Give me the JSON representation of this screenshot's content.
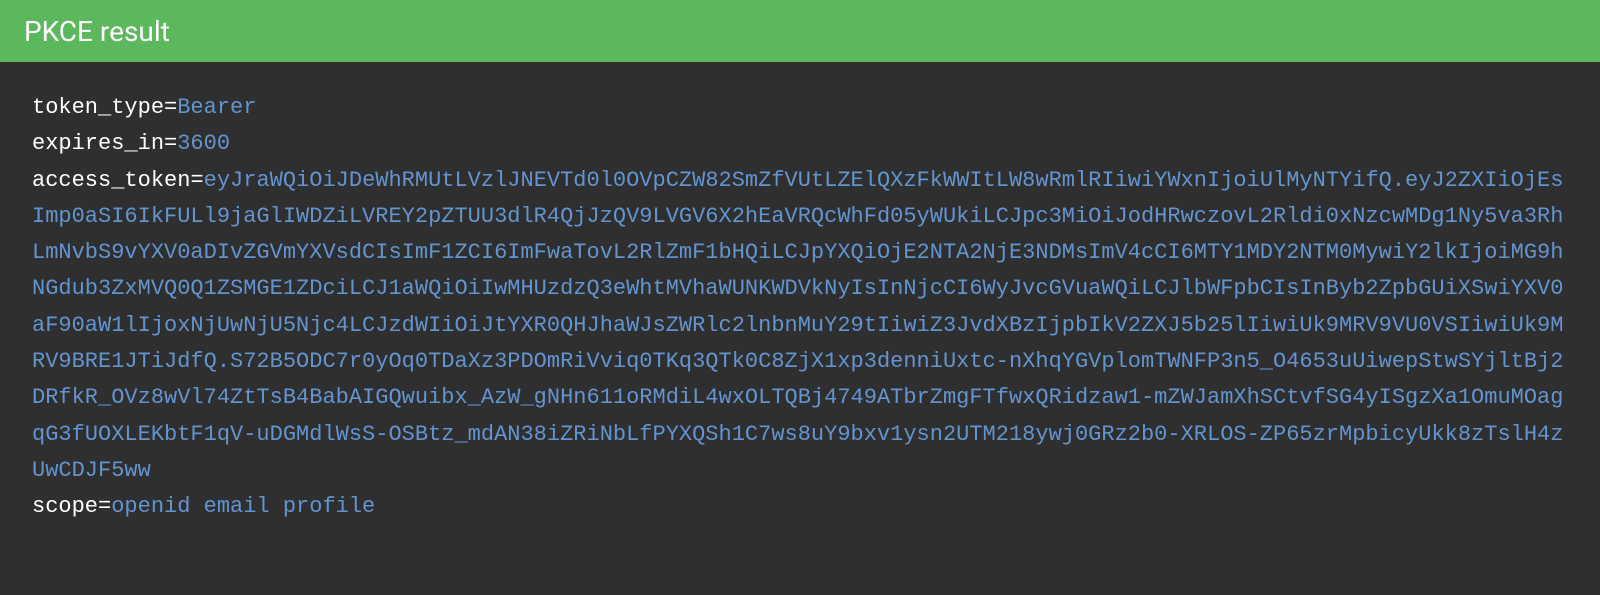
{
  "header": {
    "title": "PKCE result"
  },
  "result": {
    "entries": [
      {
        "key": "token_type",
        "value": "Bearer"
      },
      {
        "key": "expires_in",
        "value": "3600"
      },
      {
        "key": "access_token",
        "value": "eyJraWQiOiJDeWhRMUtLVzlJNEVTd0l0OVpCZW82SmZfVUtLZElQXzFkWWItLW8wRmlRIiwiYWxnIjoiUlMyNTYifQ.eyJ2ZXIiOjEsImp0aSI6IkFULl9jaGlIWDZiLVREY2pZTUU3dlR4QjJzQV9LVGV6X2hEaVRQcWhFd05yWUkiLCJpc3MiOiJodHRwczovL2Rldi0xNzcwMDg1Ny5va3RhLmNvbS9vYXV0aDIvZGVmYXVsdCIsImF1ZCI6ImFwaTovL2RlZmF1bHQiLCJpYXQiOjE2NTA2NjE3NDMsImV4cCI6MTY1MDY2NTM0MywiY2lkIjoiMG9hNGdub3ZxMVQ0Q1ZSMGE1ZDciLCJ1aWQiOiIwMHUzdzQ3eWhtMVhaWUNKWDVkNyIsInNjcCI6WyJvcGVuaWQiLCJlbWFpbCIsInByb2ZpbGUiXSwiYXV0aF90aW1lIjoxNjUwNjU5Njc4LCJzdWIiOiJtYXR0QHJhaWJsZWRlc2lnbnMuY29tIiwiZ3JvdXBzIjpbIkV2ZXJ5b25lIiwiUk9MRV9VU0VSIiwiUk9MRV9BRE1JTiJdfQ.S72B5ODC7r0yOq0TDaXz3PDOmRiVviq0TKq3QTk0C8ZjX1xp3denniUxtc-nXhqYGVplomTWNFP3n5_O4653uUiwepStwSYjltBj2DRfkR_OVz8wVl74ZtTsB4BabAIGQwuibx_AzW_gNHn611oRMdiL4wxOLTQBj4749ATbrZmgFTfwxQRidzaw1-mZWJamXhSCtvfSG4yISgzXa1OmuMOagqG3fUOXLEKbtF1qV-uDGMdlWsS-OSBtz_mdAN38iZRiNbLfPYXQSh1C7ws8uY9bxv1ysn2UTM218ywj0GRz2b0-XRLOS-ZP65zrMpbicyUkk8zTslH4zUwCDJF5ww"
      },
      {
        "key": "scope",
        "value": "openid email profile"
      }
    ]
  }
}
